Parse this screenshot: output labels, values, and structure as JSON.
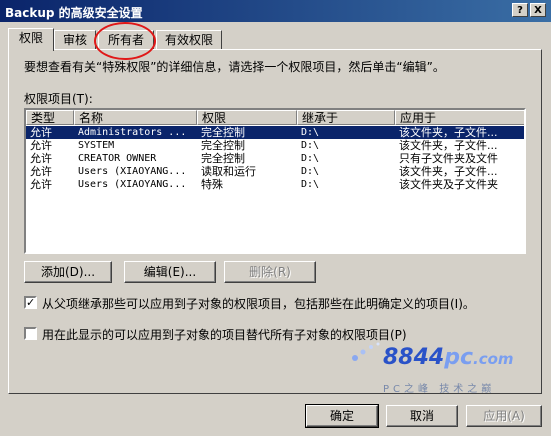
{
  "window": {
    "title": "Backup 的高级安全设置",
    "help_button": "?",
    "close_button": "X"
  },
  "tabs": [
    {
      "label": "权限"
    },
    {
      "label": "审核"
    },
    {
      "label": "所有者"
    },
    {
      "label": "有效权限"
    }
  ],
  "intro_text": "要想查看有关“特殊权限”的详细信息，请选择一个权限项目，然后单击“编辑”。",
  "list_label": "权限项目(T):",
  "columns": [
    "类型",
    "名称",
    "权限",
    "继承于",
    "应用于"
  ],
  "rows": [
    {
      "type": "允许",
      "name": "Administrators ...",
      "permission": "完全控制",
      "inherited": "D:\\",
      "applies": "该文件夹，子文件..."
    },
    {
      "type": "允许",
      "name": "SYSTEM",
      "permission": "完全控制",
      "inherited": "D:\\",
      "applies": "该文件夹，子文件..."
    },
    {
      "type": "允许",
      "name": "CREATOR OWNER",
      "permission": "完全控制",
      "inherited": "D:\\",
      "applies": "只有子文件夹及文件"
    },
    {
      "type": "允许",
      "name": "Users (XIAOYANG...",
      "permission": "读取和运行",
      "inherited": "D:\\",
      "applies": "该文件夹，子文件..."
    },
    {
      "type": "允许",
      "name": "Users (XIAOYANG...",
      "permission": "特殊",
      "inherited": "D:\\",
      "applies": "该文件夹及子文件夹"
    }
  ],
  "buttons": {
    "add": "添加(D)...",
    "edit": "编辑(E)...",
    "remove": "删除(R)"
  },
  "checkboxes": {
    "inherit_label": "从父项继承那些可以应用到子对象的权限项目，包括那些在此明确定义的项目(I)。",
    "inherit_checked": "✓",
    "replace_label": "用在此显示的可以应用到子对象的项目替代所有子对象的权限项目(P)"
  },
  "watermark": {
    "logo_main": "8844",
    "logo_pc": "pc",
    "logo_domain": ".com",
    "tagline": "PC之峰 技术之巅"
  },
  "footer": {
    "ok": "确定",
    "cancel": "取消",
    "apply": "应用(A)"
  },
  "colors": {
    "selection": "#0a246a",
    "titlebar": "#0a246a",
    "annotation": "#e01818"
  }
}
